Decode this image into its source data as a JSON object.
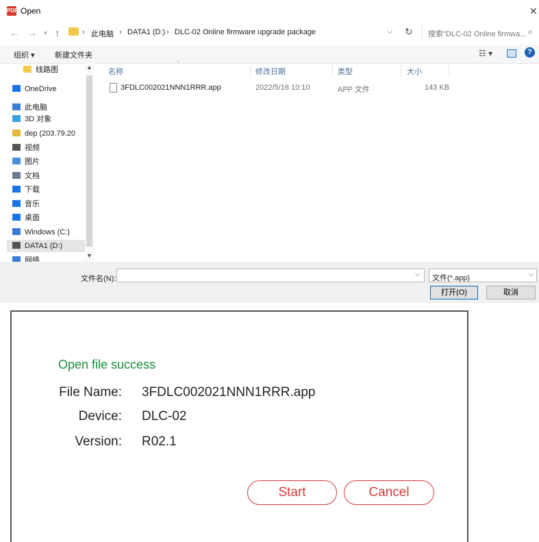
{
  "window": {
    "title": "Open",
    "icon_text": "PDF",
    "close_glyph": "✕"
  },
  "address": {
    "crumbs": [
      "此电脑",
      "DATA1 (D:)",
      "DLC-02 Online firmware upgrade package"
    ],
    "separator": "›",
    "search_placeholder": "搜索\"DLC-02 Online firmwa..."
  },
  "toolbar": {
    "organize": "组织 ▾",
    "new_folder": "新建文件夹"
  },
  "nav": {
    "items": [
      {
        "label": "线路图",
        "icon": "folder-icon",
        "color": "#f2c94c"
      },
      {
        "label": "OneDrive",
        "icon": "cloud-icon",
        "color": "#1a73e8"
      },
      {
        "label": "此电脑",
        "icon": "computer-icon",
        "color": "#3a7bd5"
      },
      {
        "label": "3D 对象",
        "icon": "3d-objects-icon",
        "color": "#3aa0e0"
      },
      {
        "label": "dep (203.79.20",
        "icon": "network-drive-icon",
        "color": "#e2b93b"
      },
      {
        "label": "视频",
        "icon": "video-icon",
        "color": "#555555"
      },
      {
        "label": "图片",
        "icon": "pictures-icon",
        "color": "#4a90d9"
      },
      {
        "label": "文档",
        "icon": "documents-icon",
        "color": "#6b7c93"
      },
      {
        "label": "下载",
        "icon": "download-icon",
        "color": "#1a73e8"
      },
      {
        "label": "音乐",
        "icon": "music-icon",
        "color": "#1a73e8"
      },
      {
        "label": "桌面",
        "icon": "desktop-icon",
        "color": "#1a73e8"
      },
      {
        "label": "Windows (C:)",
        "icon": "drive-c-icon",
        "color": "#3a7bd5"
      },
      {
        "label": "DATA1 (D:)",
        "icon": "drive-d-icon",
        "color": "#555555"
      },
      {
        "label": "网络",
        "icon": "network-icon",
        "color": "#3a7bd5"
      }
    ]
  },
  "filelist": {
    "columns": [
      "名称",
      "修改日期",
      "类型",
      "大小"
    ],
    "rows": [
      {
        "name": "3FDLC002021NNN1RRR.app",
        "modified": "2022/5/16 10:10",
        "type": "APP 文件",
        "size": "143 KB"
      }
    ]
  },
  "bottom": {
    "filename_label": "文件名(N):",
    "filename_value": "",
    "filter_value": "文件(*.app)",
    "open_label": "打开(O)",
    "cancel_label": "取消"
  },
  "result": {
    "status": "Open file success",
    "rows": [
      {
        "label": "File Name:",
        "value": "3FDLC002021NNN1RRR.app"
      },
      {
        "label": "Device:",
        "value": "DLC-02"
      },
      {
        "label": "Version:",
        "value": "R02.1"
      }
    ],
    "start_label": "Start",
    "cancel_label": "Cancel"
  },
  "colors": {
    "success": "#1e8c3a",
    "accent_red": "#d43a3a",
    "link_blue": "#4a6f97"
  }
}
